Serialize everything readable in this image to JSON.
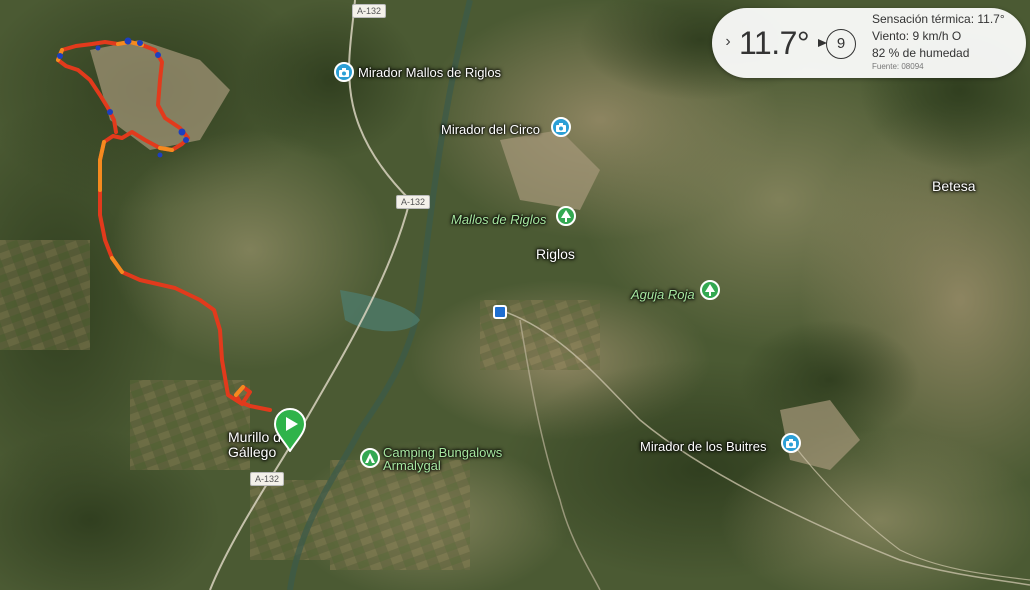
{
  "map": {
    "pois": [
      {
        "name": "mirador-mallos-de-riglos",
        "label": "Mirador Mallos de Riglos",
        "kind": "camera"
      },
      {
        "name": "mirador-del-circo",
        "label": "Mirador del Circo",
        "kind": "camera"
      },
      {
        "name": "mallos-de-riglos",
        "label": "Mallos de Riglos",
        "kind": "park"
      },
      {
        "name": "aguja-roja",
        "label": "Aguja Roja",
        "kind": "park"
      },
      {
        "name": "mirador-de-los-buitres",
        "label": "Mirador de los Buitres",
        "kind": "camera"
      },
      {
        "name": "camping-bungalows-armalygal",
        "label": "Camping Bungalows\nArmalygal",
        "kind": "camping"
      }
    ],
    "places": {
      "riglos": "Riglos",
      "betesa": "Betesa",
      "murillo": "Murillo de\nGállego"
    },
    "roads": [
      "A-132",
      "A-132",
      "A-132"
    ],
    "colors": {
      "track_red": "#e23a1c",
      "track_orange": "#f58a1f",
      "track_blue": "#1d3fbf",
      "start_pin": "#2fb34a",
      "camera_pin": "#2b9fd6",
      "park_pin": "#33a852"
    },
    "icons": {
      "camera": "camera-icon",
      "park": "tree-icon",
      "start": "play-icon",
      "bus": "bus-icon"
    }
  },
  "weather": {
    "temperature": "11.7°",
    "wind_speed": "9",
    "feels_like": "Sensación térmica: 11.7°",
    "wind": "Viento: 9 km/h O",
    "humidity": "82 % de humedad",
    "source": "Fuente: 08094",
    "expand_icon": "chevron-right-icon"
  }
}
